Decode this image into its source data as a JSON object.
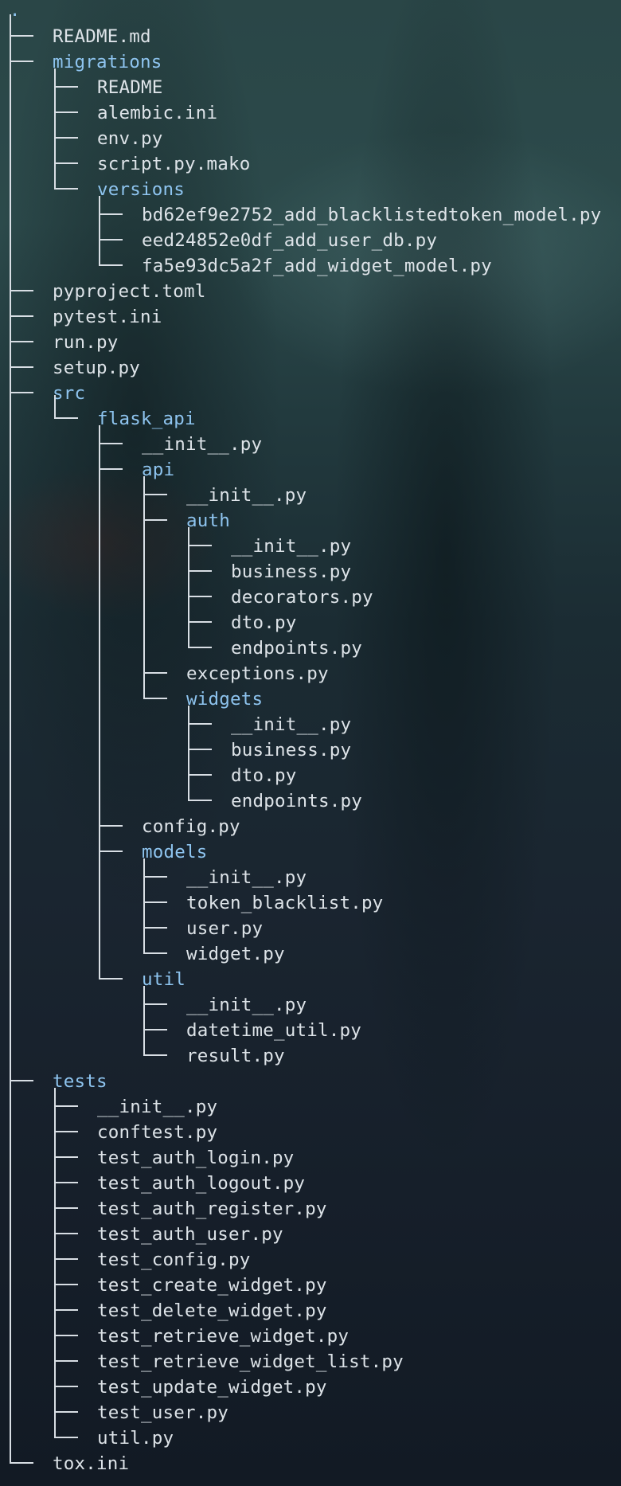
{
  "root": {
    "name": "."
  },
  "entries": [
    {
      "name": "README.md",
      "depth": 0,
      "dir": false
    },
    {
      "name": "migrations",
      "depth": 0,
      "dir": true
    },
    {
      "name": "README",
      "depth": 1,
      "dir": false
    },
    {
      "name": "alembic.ini",
      "depth": 1,
      "dir": false
    },
    {
      "name": "env.py",
      "depth": 1,
      "dir": false
    },
    {
      "name": "script.py.mako",
      "depth": 1,
      "dir": false
    },
    {
      "name": "versions",
      "depth": 1,
      "dir": true
    },
    {
      "name": "bd62ef9e2752_add_blacklistedtoken_model.py",
      "depth": 2,
      "dir": false
    },
    {
      "name": "eed24852e0df_add_user_db.py",
      "depth": 2,
      "dir": false
    },
    {
      "name": "fa5e93dc5a2f_add_widget_model.py",
      "depth": 2,
      "dir": false
    },
    {
      "name": "pyproject.toml",
      "depth": 0,
      "dir": false
    },
    {
      "name": "pytest.ini",
      "depth": 0,
      "dir": false
    },
    {
      "name": "run.py",
      "depth": 0,
      "dir": false
    },
    {
      "name": "setup.py",
      "depth": 0,
      "dir": false
    },
    {
      "name": "src",
      "depth": 0,
      "dir": true
    },
    {
      "name": "flask_api",
      "depth": 1,
      "dir": true
    },
    {
      "name": "__init__.py",
      "depth": 2,
      "dir": false
    },
    {
      "name": "api",
      "depth": 2,
      "dir": true
    },
    {
      "name": "__init__.py",
      "depth": 3,
      "dir": false
    },
    {
      "name": "auth",
      "depth": 3,
      "dir": true
    },
    {
      "name": "__init__.py",
      "depth": 4,
      "dir": false
    },
    {
      "name": "business.py",
      "depth": 4,
      "dir": false
    },
    {
      "name": "decorators.py",
      "depth": 4,
      "dir": false
    },
    {
      "name": "dto.py",
      "depth": 4,
      "dir": false
    },
    {
      "name": "endpoints.py",
      "depth": 4,
      "dir": false
    },
    {
      "name": "exceptions.py",
      "depth": 3,
      "dir": false
    },
    {
      "name": "widgets",
      "depth": 3,
      "dir": true
    },
    {
      "name": "__init__.py",
      "depth": 4,
      "dir": false
    },
    {
      "name": "business.py",
      "depth": 4,
      "dir": false
    },
    {
      "name": "dto.py",
      "depth": 4,
      "dir": false
    },
    {
      "name": "endpoints.py",
      "depth": 4,
      "dir": false
    },
    {
      "name": "config.py",
      "depth": 2,
      "dir": false
    },
    {
      "name": "models",
      "depth": 2,
      "dir": true
    },
    {
      "name": "__init__.py",
      "depth": 3,
      "dir": false
    },
    {
      "name": "token_blacklist.py",
      "depth": 3,
      "dir": false
    },
    {
      "name": "user.py",
      "depth": 3,
      "dir": false
    },
    {
      "name": "widget.py",
      "depth": 3,
      "dir": false
    },
    {
      "name": "util",
      "depth": 2,
      "dir": true
    },
    {
      "name": "__init__.py",
      "depth": 3,
      "dir": false
    },
    {
      "name": "datetime_util.py",
      "depth": 3,
      "dir": false
    },
    {
      "name": "result.py",
      "depth": 3,
      "dir": false
    },
    {
      "name": "tests",
      "depth": 0,
      "dir": true
    },
    {
      "name": "__init__.py",
      "depth": 1,
      "dir": false
    },
    {
      "name": "conftest.py",
      "depth": 1,
      "dir": false
    },
    {
      "name": "test_auth_login.py",
      "depth": 1,
      "dir": false
    },
    {
      "name": "test_auth_logout.py",
      "depth": 1,
      "dir": false
    },
    {
      "name": "test_auth_register.py",
      "depth": 1,
      "dir": false
    },
    {
      "name": "test_auth_user.py",
      "depth": 1,
      "dir": false
    },
    {
      "name": "test_config.py",
      "depth": 1,
      "dir": false
    },
    {
      "name": "test_create_widget.py",
      "depth": 1,
      "dir": false
    },
    {
      "name": "test_delete_widget.py",
      "depth": 1,
      "dir": false
    },
    {
      "name": "test_retrieve_widget.py",
      "depth": 1,
      "dir": false
    },
    {
      "name": "test_retrieve_widget_list.py",
      "depth": 1,
      "dir": false
    },
    {
      "name": "test_update_widget.py",
      "depth": 1,
      "dir": false
    },
    {
      "name": "test_user.py",
      "depth": 1,
      "dir": false
    },
    {
      "name": "util.py",
      "depth": 1,
      "dir": false
    },
    {
      "name": "tox.ini",
      "depth": 0,
      "dir": false
    }
  ],
  "colors": {
    "file_text": "#dde3e8",
    "dir_text": "#8ec4ef",
    "tree_lines": "#d8dee4"
  }
}
